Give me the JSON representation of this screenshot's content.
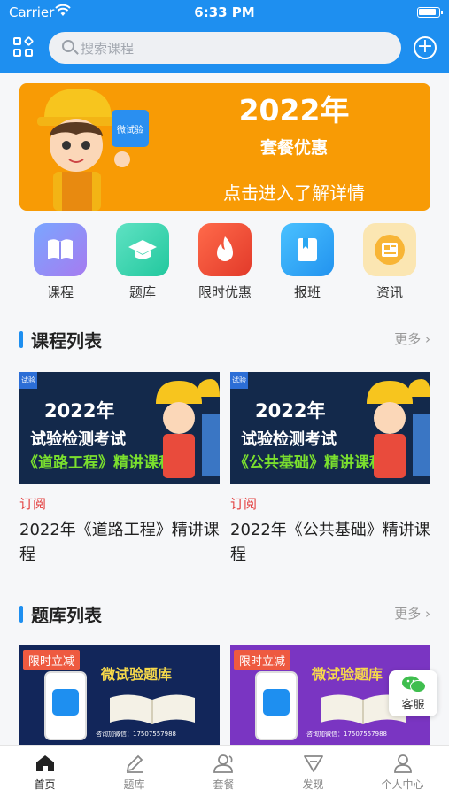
{
  "status_bar": {
    "carrier": "Carrier",
    "time": "6:33 PM"
  },
  "header": {
    "search_placeholder": "搜索课程"
  },
  "banner": {
    "year": "2022年",
    "subtitle": "套餐优惠",
    "cta": "点击进入了解详情",
    "badge": "微试验"
  },
  "quick_nav": [
    {
      "label": "课程",
      "icon": "book-icon",
      "color": "#8f8df3"
    },
    {
      "label": "题库",
      "icon": "graduation-cap-icon",
      "color": "#2dd3ae"
    },
    {
      "label": "限时优惠",
      "icon": "flame-icon",
      "color": "#f04d35"
    },
    {
      "label": "报班",
      "icon": "bookmark-book-icon",
      "color": "#2aa7f2"
    },
    {
      "label": "资讯",
      "icon": "news-icon",
      "color": "#f6c44f"
    }
  ],
  "course_section": {
    "title": "课程列表",
    "more": "更多",
    "items": [
      {
        "thumb_year": "2022年",
        "thumb_line": "试验检测考试",
        "thumb_course": "《道路工程》精讲课程",
        "tag": "试验",
        "sub": "订阅",
        "name": "2022年《道路工程》精讲课程"
      },
      {
        "thumb_year": "2022年",
        "thumb_line": "试验检测考试",
        "thumb_course": "《公共基础》精讲课程",
        "tag": "试验",
        "sub": "订阅",
        "name": "2022年《公共基础》精讲课程"
      }
    ]
  },
  "bank_section": {
    "title": "题库列表",
    "more": "更多",
    "items": [
      {
        "badge": "限时立减",
        "title": "微试验题库",
        "contact": "咨询加微信：17507557988",
        "bg": "#12265a"
      },
      {
        "badge": "限时立减",
        "title": "微试验题库",
        "contact": "咨询加微信：17507557988",
        "bg": "#7a35c2"
      }
    ]
  },
  "service_button": {
    "label": "客服"
  },
  "tabs": [
    {
      "label": "首页",
      "icon": "home-icon",
      "active": true
    },
    {
      "label": "题库",
      "icon": "pencil-icon",
      "active": false
    },
    {
      "label": "套餐",
      "icon": "users-icon",
      "active": false
    },
    {
      "label": "发现",
      "icon": "discover-icon",
      "active": false
    },
    {
      "label": "个人中心",
      "icon": "person-icon",
      "active": false
    }
  ]
}
